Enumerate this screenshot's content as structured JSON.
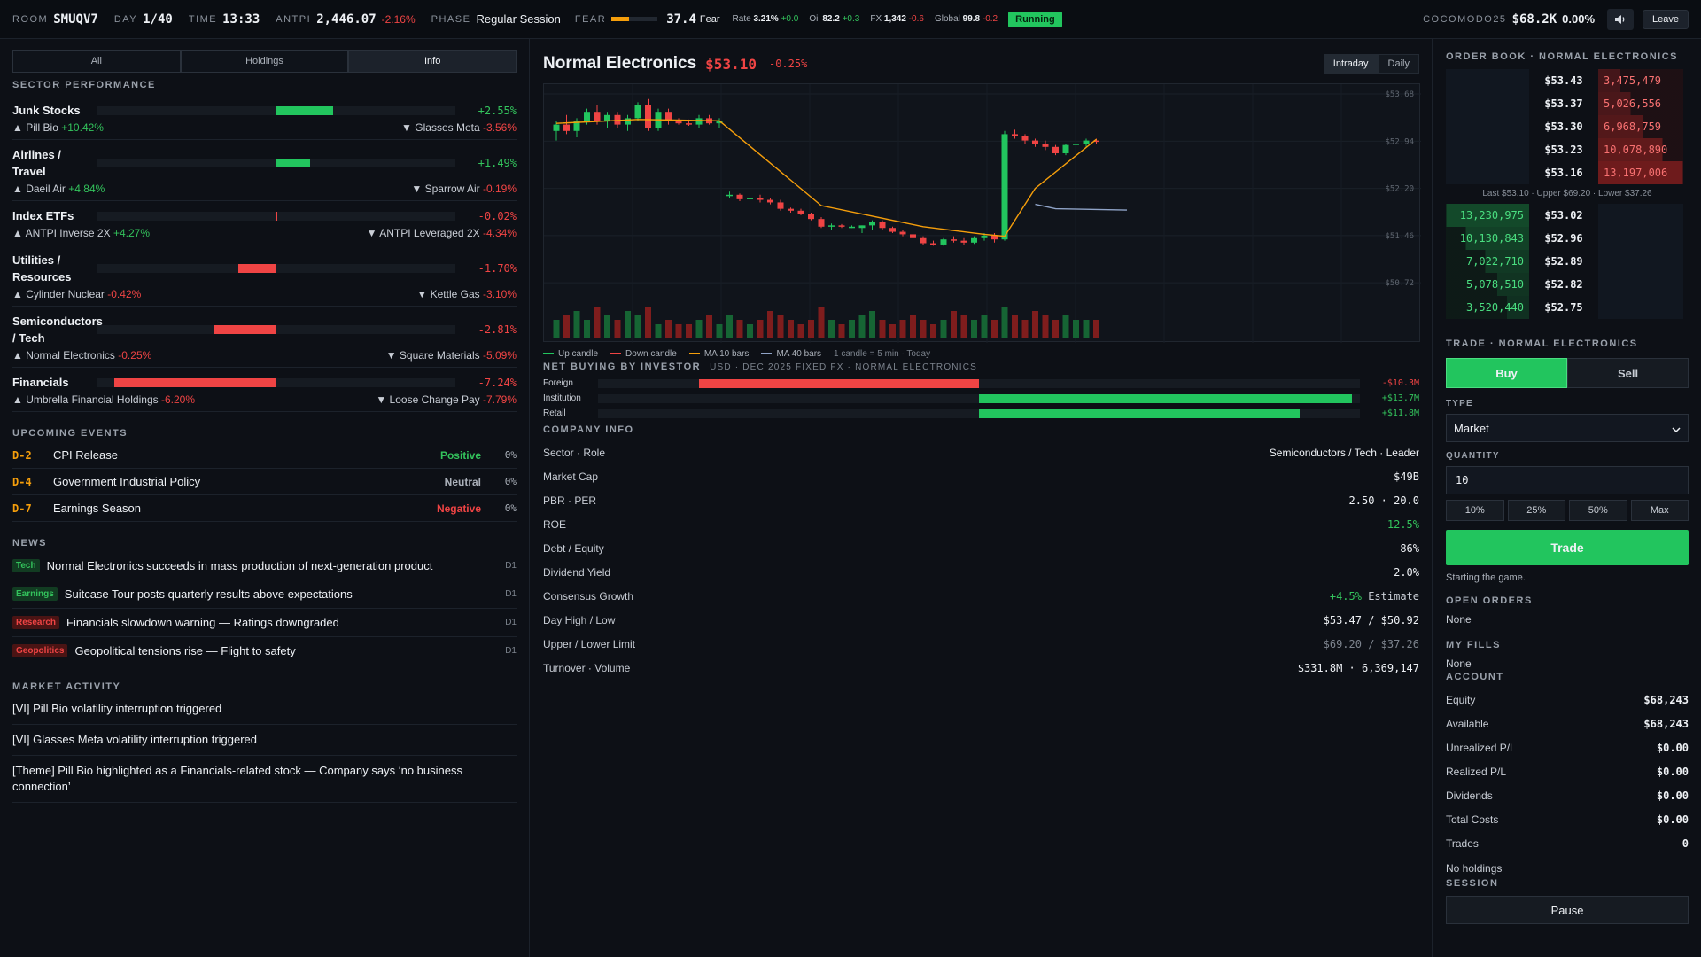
{
  "topbar": {
    "room_label": "ROOM",
    "room": "SMUQV7",
    "day_label": "DAY",
    "day": "1/40",
    "time_label": "TIME",
    "time": "13:33",
    "index_label": "ANTPI",
    "index_value": "2,446.07",
    "index_change": "-2.16%",
    "phase_label": "PHASE",
    "phase": "Regular Session",
    "fear_label": "FEAR",
    "fear_value": "37.4",
    "fear_text": "Fear",
    "fear_level": 0.374,
    "rate_label": "Rate",
    "rate_value": "3.21%",
    "rate_change": "+0.0",
    "oil_label": "Oil",
    "oil_value": "82.2",
    "oil_change": "+0.3",
    "fx_label": "FX",
    "fx_value": "1,342",
    "fx_change": "-0.6",
    "global_label": "Global",
    "global_value": "99.8",
    "global_change": "-0.2",
    "status": "Running",
    "user_label": "COCOMODO25",
    "user_equity": "$68.2K",
    "user_return": "0.00%",
    "sound_icon": "speaker-icon",
    "leave_label": "Leave"
  },
  "left": {
    "tabs": [
      "All",
      "Holdings",
      "Info"
    ],
    "active_tab": 2,
    "sector_heading": "SECTOR PERFORMANCE",
    "sectors": [
      {
        "name": "Junk Stocks",
        "pct": "+2.55%",
        "value": 2.55,
        "top": "Pill Bio",
        "top_pct": "+10.42%",
        "bottom": "Glasses Meta",
        "bottom_pct": "-3.56%"
      },
      {
        "name": "Airlines / Travel",
        "pct": "+1.49%",
        "value": 1.49,
        "top": "Daeil Air",
        "top_pct": "+4.84%",
        "bottom": "Sparrow Air",
        "bottom_pct": "-0.19%"
      },
      {
        "name": "Index ETFs",
        "pct": "-0.02%",
        "value": -0.02,
        "top": "ANTPI Inverse 2X",
        "top_pct": "+4.27%",
        "bottom": "ANTPI Leveraged 2X",
        "bottom_pct": "-4.34%"
      },
      {
        "name": "Utilities / Resources",
        "pct": "-1.70%",
        "value": -1.7,
        "top": "Cylinder Nuclear",
        "top_pct": "-0.42%",
        "bottom": "Kettle Gas",
        "bottom_pct": "-3.10%"
      },
      {
        "name": "Semiconductors / Tech",
        "pct": "-2.81%",
        "value": -2.81,
        "top": "Normal Electronics",
        "top_pct": "-0.25%",
        "bottom": "Square Materials",
        "bottom_pct": "-5.09%"
      },
      {
        "name": "Financials",
        "pct": "-7.24%",
        "value": -7.24,
        "top": "Umbrella Financial Holdings",
        "top_pct": "-6.20%",
        "bottom": "Loose Change Pay",
        "bottom_pct": "-7.79%"
      }
    ],
    "events_heading": "UPCOMING EVENTS",
    "events": [
      {
        "day": "D-2",
        "title": "CPI Release",
        "sentiment": "Positive",
        "prob": "0%"
      },
      {
        "day": "D-4",
        "title": "Government Industrial Policy",
        "sentiment": "Neutral",
        "prob": "0%"
      },
      {
        "day": "D-7",
        "title": "Earnings Season",
        "sentiment": "Negative",
        "prob": "0%"
      }
    ],
    "news_heading": "NEWS",
    "news": [
      {
        "tag": "Tech",
        "title": "Normal Electronics succeeds in mass production of next-generation product",
        "day": "D1",
        "color": "#33c35c"
      },
      {
        "tag": "Earnings",
        "title": "Suitcase Tour posts quarterly results above expectations",
        "day": "D1",
        "color": "#33c35c"
      },
      {
        "tag": "Research",
        "title": "Financials slowdown warning — Ratings downgraded",
        "day": "D1",
        "color": "#ef4444"
      },
      {
        "tag": "Geopolitics",
        "title": "Geopolitical tensions rise — Flight to safety",
        "day": "D1",
        "color": "#ef4444"
      }
    ],
    "activity_heading": "MARKET ACTIVITY",
    "activity": [
      "[VI] Pill Bio volatility interruption triggered",
      "[VI] Glasses Meta volatility interruption triggered",
      "[Theme] Pill Bio highlighted as a Financials-related stock — Company says ‘no business connection’"
    ]
  },
  "center": {
    "stock_name": "Normal Electronics",
    "price": "$53.10",
    "change": "-0.25%",
    "modes": [
      "Intraday",
      "Daily"
    ],
    "active_mode": 0,
    "chart_data": {
      "type": "candlestick",
      "y_ticks": [
        "$53.68",
        "$52.94",
        "$52.20",
        "$51.46",
        "$50.72"
      ],
      "ylim": [
        50.5,
        53.75
      ],
      "candles": [
        [
          53.1,
          53.25,
          52.95,
          53.2
        ],
        [
          53.2,
          53.35,
          53.05,
          53.1
        ],
        [
          53.1,
          53.3,
          53.0,
          53.25
        ],
        [
          53.25,
          53.45,
          53.2,
          53.4
        ],
        [
          53.4,
          53.5,
          53.2,
          53.25
        ],
        [
          53.25,
          53.4,
          53.15,
          53.35
        ],
        [
          53.35,
          53.4,
          53.15,
          53.2
        ],
        [
          53.2,
          53.35,
          53.1,
          53.3
        ],
        [
          53.3,
          53.55,
          53.25,
          53.5
        ],
        [
          53.5,
          53.6,
          53.1,
          53.15
        ],
        [
          53.15,
          53.45,
          53.1,
          53.4
        ],
        [
          53.4,
          53.45,
          53.2,
          53.25
        ],
        [
          53.25,
          53.3,
          53.2,
          53.22
        ],
        [
          53.22,
          53.28,
          53.18,
          53.2
        ],
        [
          53.2,
          53.35,
          53.15,
          53.3
        ],
        [
          53.3,
          53.35,
          53.2,
          53.22
        ],
        [
          53.22,
          53.3,
          53.15,
          53.25
        ],
        [
          52.1,
          52.15,
          52.05,
          52.1
        ],
        [
          52.1,
          52.12,
          52.0,
          52.03
        ],
        [
          52.03,
          52.08,
          51.98,
          52.05
        ],
        [
          52.05,
          52.1,
          51.98,
          52.02
        ],
        [
          52.02,
          52.05,
          51.95,
          51.98
        ],
        [
          51.98,
          52.02,
          51.85,
          51.88
        ],
        [
          51.88,
          51.9,
          51.82,
          51.85
        ],
        [
          51.85,
          51.88,
          51.78,
          51.8
        ],
        [
          51.8,
          51.82,
          51.7,
          51.72
        ],
        [
          51.72,
          51.75,
          51.58,
          51.6
        ],
        [
          51.6,
          51.65,
          51.55,
          51.62
        ],
        [
          51.62,
          51.64,
          51.58,
          51.6
        ],
        [
          51.6,
          51.62,
          51.58,
          51.6
        ],
        [
          51.58,
          51.62,
          51.5,
          51.62
        ],
        [
          51.62,
          51.7,
          51.55,
          51.68
        ],
        [
          51.68,
          51.7,
          51.55,
          51.58
        ],
        [
          51.58,
          51.6,
          51.5,
          51.52
        ],
        [
          51.52,
          51.55,
          51.45,
          51.48
        ],
        [
          51.48,
          51.52,
          51.4,
          51.42
        ],
        [
          51.42,
          51.45,
          51.32,
          51.34
        ],
        [
          51.34,
          51.38,
          51.3,
          51.32
        ],
        [
          51.32,
          51.42,
          51.3,
          51.4
        ],
        [
          51.4,
          51.45,
          51.35,
          51.38
        ],
        [
          51.38,
          51.42,
          51.32,
          51.35
        ],
        [
          51.35,
          51.45,
          51.33,
          51.42
        ],
        [
          51.42,
          51.5,
          51.38,
          51.46
        ],
        [
          51.46,
          51.5,
          51.35,
          51.4
        ],
        [
          51.4,
          53.1,
          51.38,
          53.05
        ],
        [
          53.05,
          53.12,
          52.98,
          53.02
        ],
        [
          53.02,
          53.05,
          52.9,
          52.95
        ],
        [
          52.95,
          52.98,
          52.85,
          52.9
        ],
        [
          52.9,
          52.95,
          52.8,
          52.85
        ],
        [
          52.85,
          52.88,
          52.72,
          52.75
        ],
        [
          52.75,
          52.9,
          52.72,
          52.88
        ],
        [
          52.88,
          52.95,
          52.82,
          52.9
        ],
        [
          52.9,
          52.98,
          52.85,
          52.95
        ],
        [
          52.95,
          52.98,
          52.9,
          52.93
        ]
      ],
      "ma10": [
        [
          8,
          53.28
        ],
        [
          16,
          53.25
        ],
        [
          26,
          51.9
        ],
        [
          36,
          51.72
        ],
        [
          43,
          51.55
        ],
        [
          47,
          51.5
        ]
      ],
      "ma40": [
        [
          47,
          51.95
        ],
        [
          49,
          51.88
        ],
        [
          56,
          51.86
        ]
      ],
      "volumes": [
        4,
        5,
        6,
        4,
        7,
        5,
        4,
        6,
        5,
        7,
        3,
        4,
        3,
        3,
        4,
        5,
        3,
        5,
        4,
        3,
        4,
        6,
        5,
        4,
        3,
        4,
        7,
        4,
        3,
        4,
        5,
        6,
        4,
        3,
        4,
        5,
        4,
        3,
        4,
        6,
        5,
        4,
        5,
        4,
        7,
        5,
        4,
        6,
        5,
        4,
        5,
        4,
        4,
        4
      ]
    },
    "legend": [
      {
        "label": "Up candle",
        "color": "#22c55e"
      },
      {
        "label": "Down candle",
        "color": "#ef4444"
      },
      {
        "label": "MA 10 bars",
        "color": "#f59e0b"
      },
      {
        "label": "MA 40 bars",
        "color": "#8fa3c7"
      }
    ],
    "legend_note": "1 candle = 5 min · Today",
    "net_heading": "NET BUYING BY INVESTOR",
    "net_sub": "USD · DEC 2025 FIXED FX · NORMAL ELECTRONICS",
    "net": [
      {
        "label": "Foreign",
        "value": "-$10.3M",
        "amount": -10.3
      },
      {
        "label": "Institution",
        "value": "+$13.7M",
        "amount": 13.7
      },
      {
        "label": "Retail",
        "value": "+$11.8M",
        "amount": 11.8
      }
    ],
    "company_heading": "COMPANY INFO",
    "company": [
      {
        "k": "Sector · Role",
        "v": "Semiconductors / Tech · Leader"
      },
      {
        "k": "Market Cap",
        "v": "$49B"
      },
      {
        "k": "PBR · PER",
        "v": "2.50 · 20.0"
      },
      {
        "k": "ROE",
        "v": "12.5%"
      },
      {
        "k": "Debt / Equity",
        "v": "86%"
      },
      {
        "k": "Dividend Yield",
        "v": "2.0%"
      },
      {
        "k": "Consensus Growth",
        "v": "+4.5%",
        "v2": "Estimate"
      },
      {
        "k": "Day High / Low",
        "v": "$53.47 / $50.92"
      },
      {
        "k": "Upper / Lower Limit",
        "v": "$69.20 / $37.26"
      },
      {
        "k": "Turnover · Volume",
        "v": "$331.8M · 6,369,147"
      }
    ]
  },
  "right": {
    "ob_heading": "ORDER BOOK · NORMAL ELECTRONICS",
    "asks": [
      {
        "price": "$53.43",
        "qty": "3,475,479",
        "size": 3475479
      },
      {
        "price": "$53.37",
        "qty": "5,026,556",
        "size": 5026556
      },
      {
        "price": "$53.30",
        "qty": "6,968,759",
        "size": 6968759
      },
      {
        "price": "$53.23",
        "qty": "10,078,890",
        "size": 10078890
      },
      {
        "price": "$53.16",
        "qty": "13,197,006",
        "size": 13197006
      }
    ],
    "ob_mid": "Last $53.10 · Upper $69.20 · Lower $37.26",
    "bids": [
      {
        "price": "$53.02",
        "qty": "13,230,975",
        "size": 13230975
      },
      {
        "price": "$52.96",
        "qty": "10,130,843",
        "size": 10130843
      },
      {
        "price": "$52.89",
        "qty": "7,022,710",
        "size": 7022710
      },
      {
        "price": "$52.82",
        "qty": "5,078,510",
        "size": 5078510
      },
      {
        "price": "$52.75",
        "qty": "3,520,440",
        "size": 3520440
      }
    ],
    "trade_heading": "TRADE · NORMAL ELECTRONICS",
    "buy_label": "Buy",
    "sell_label": "Sell",
    "type_label": "TYPE",
    "type_value": "Market",
    "qty_label": "QUANTITY",
    "qty_value": "10",
    "pcts": [
      "10%",
      "25%",
      "50%",
      "Max"
    ],
    "trade_label": "Trade",
    "trade_note": "Starting the game.",
    "orders_heading": "OPEN ORDERS",
    "orders_none": "None",
    "fills_heading": "MY FILLS",
    "fills_none": "None",
    "account_heading": "ACCOUNT",
    "account": [
      {
        "k": "Equity",
        "v": "$68,243"
      },
      {
        "k": "Available",
        "v": "$68,243"
      },
      {
        "k": "Unrealized P/L",
        "v": "$0.00"
      },
      {
        "k": "Realized P/L",
        "v": "$0.00"
      },
      {
        "k": "Dividends",
        "v": "$0.00"
      },
      {
        "k": "Total Costs",
        "v": "$0.00"
      },
      {
        "k": "Trades",
        "v": "0"
      }
    ],
    "holdings_none": "No holdings",
    "session_heading": "SESSION",
    "pause_label": "Pause"
  },
  "colors": {
    "up": "#22c55e",
    "down": "#ef4444",
    "accent": "#f59e0b",
    "ma40": "#8fa3c7"
  }
}
